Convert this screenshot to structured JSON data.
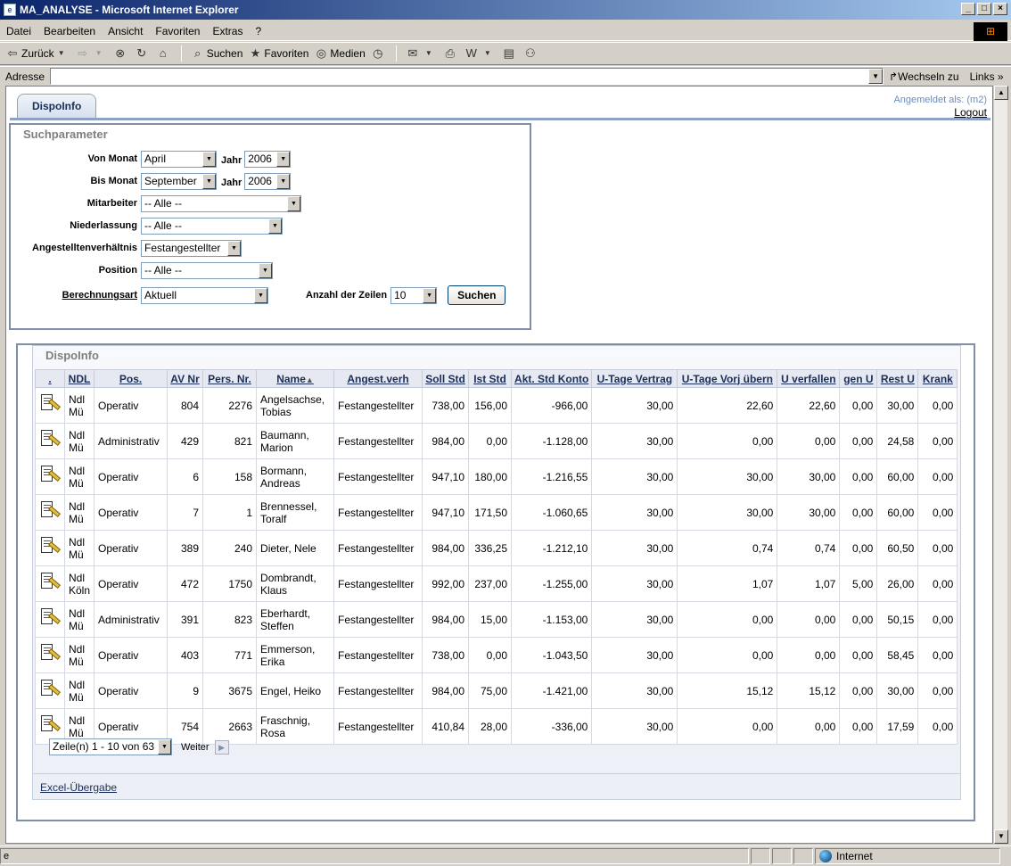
{
  "window": {
    "title": "MA_ANALYSE - Microsoft Internet Explorer"
  },
  "menu": [
    "Datei",
    "Bearbeiten",
    "Ansicht",
    "Favoriten",
    "Extras",
    "?"
  ],
  "toolbar": {
    "back": "Zurück",
    "search": "Suchen",
    "favorites": "Favoriten",
    "media": "Medien"
  },
  "address": {
    "label": "Adresse",
    "value": "",
    "go": "Wechseln zu",
    "links": "Links"
  },
  "status": {
    "zone": "Internet"
  },
  "page": {
    "tab": "DispoInfo",
    "logged_in": "Angemeldet als:  (m2)",
    "logout": "Logout"
  },
  "search": {
    "title": "Suchparameter",
    "von_monat_label": "Von Monat",
    "von_monat": "April",
    "jahr_label": "Jahr",
    "von_jahr": "2006",
    "bis_monat_label": "Bis Monat",
    "bis_monat": "September",
    "bis_jahr": "2006",
    "mitarbeiter_label": "Mitarbeiter",
    "mitarbeiter": "-- Alle --",
    "niederlassung_label": "Niederlassung",
    "niederlassung": "-- Alle --",
    "angestellt_label": "Angestelltenverhältnis",
    "angestellt": "Festangestellter",
    "position_label": "Position",
    "position": "-- Alle --",
    "berechnung_label": "Berechnungsart",
    "berechnung": "Aktuell",
    "zeilen_label": "Anzahl der Zeilen",
    "zeilen": "10",
    "button": "Suchen"
  },
  "results": {
    "title": "DispoInfo",
    "columns": [
      ".",
      "NDL",
      "Pos.",
      "AV Nr",
      "Pers. Nr.",
      "Name",
      "Angest.verh",
      "Soll Std",
      "Ist Std",
      "Akt. Std Konto",
      "U-Tage Vertrag",
      "U-Tage Vorj übern",
      "U verfallen",
      "gen U",
      "Rest U",
      "Krank"
    ],
    "sort_indicator": "▲",
    "rows": [
      {
        "ndl": [
          "Ndl",
          "Mü"
        ],
        "pos": "Operativ",
        "av": "804",
        "pers": "2276",
        "name": [
          "Angelsachse,",
          "Tobias"
        ],
        "ang": "Festangestellter",
        "soll": "738,00",
        "ist": "156,00",
        "konto": "-966,00",
        "vertrag": "30,00",
        "vorj": "22,60",
        "verf": "22,60",
        "gen": "0,00",
        "rest": "30,00",
        "krank": "0,00"
      },
      {
        "ndl": [
          "Ndl",
          "Mü"
        ],
        "pos": "Administrativ",
        "av": "429",
        "pers": "821",
        "name": [
          "Baumann,",
          "Marion"
        ],
        "ang": "Festangestellter",
        "soll": "984,00",
        "ist": "0,00",
        "konto": "-1.128,00",
        "vertrag": "30,00",
        "vorj": "0,00",
        "verf": "0,00",
        "gen": "0,00",
        "rest": "24,58",
        "krank": "0,00"
      },
      {
        "ndl": [
          "Ndl",
          "Mü"
        ],
        "pos": "Operativ",
        "av": "6",
        "pers": "158",
        "name": [
          "Bormann,",
          "Andreas"
        ],
        "ang": "Festangestellter",
        "soll": "947,10",
        "ist": "180,00",
        "konto": "-1.216,55",
        "vertrag": "30,00",
        "vorj": "30,00",
        "verf": "30,00",
        "gen": "0,00",
        "rest": "60,00",
        "krank": "0,00"
      },
      {
        "ndl": [
          "Ndl",
          "Mü"
        ],
        "pos": "Operativ",
        "av": "7",
        "pers": "1",
        "name": [
          "Brennessel,",
          "Toralf"
        ],
        "ang": "Festangestellter",
        "soll": "947,10",
        "ist": "171,50",
        "konto": "-1.060,65",
        "vertrag": "30,00",
        "vorj": "30,00",
        "verf": "30,00",
        "gen": "0,00",
        "rest": "60,00",
        "krank": "0,00"
      },
      {
        "ndl": [
          "Ndl",
          "Mü"
        ],
        "pos": "Operativ",
        "av": "389",
        "pers": "240",
        "name": [
          "Dieter, Nele",
          ""
        ],
        "ang": "Festangestellter",
        "soll": "984,00",
        "ist": "336,25",
        "konto": "-1.212,10",
        "vertrag": "30,00",
        "vorj": "0,74",
        "verf": "0,74",
        "gen": "0,00",
        "rest": "60,50",
        "krank": "0,00"
      },
      {
        "ndl": [
          "Ndl",
          "Köln"
        ],
        "pos": "Operativ",
        "av": "472",
        "pers": "1750",
        "name": [
          "Dombrandt,",
          "Klaus"
        ],
        "ang": "Festangestellter",
        "soll": "992,00",
        "ist": "237,00",
        "konto": "-1.255,00",
        "vertrag": "30,00",
        "vorj": "1,07",
        "verf": "1,07",
        "gen": "5,00",
        "rest": "26,00",
        "krank": "0,00"
      },
      {
        "ndl": [
          "Ndl",
          "Mü"
        ],
        "pos": "Administrativ",
        "av": "391",
        "pers": "823",
        "name": [
          "Eberhardt,",
          "Steffen"
        ],
        "ang": "Festangestellter",
        "soll": "984,00",
        "ist": "15,00",
        "konto": "-1.153,00",
        "vertrag": "30,00",
        "vorj": "0,00",
        "verf": "0,00",
        "gen": "0,00",
        "rest": "50,15",
        "krank": "0,00"
      },
      {
        "ndl": [
          "Ndl",
          "Mü"
        ],
        "pos": "Operativ",
        "av": "403",
        "pers": "771",
        "name": [
          "Emmerson,",
          "Erika"
        ],
        "ang": "Festangestellter",
        "soll": "738,00",
        "ist": "0,00",
        "konto": "-1.043,50",
        "vertrag": "30,00",
        "vorj": "0,00",
        "verf": "0,00",
        "gen": "0,00",
        "rest": "58,45",
        "krank": "0,00"
      },
      {
        "ndl": [
          "Ndl",
          "Mü"
        ],
        "pos": "Operativ",
        "av": "9",
        "pers": "3675",
        "name": [
          "Engel, Heiko",
          ""
        ],
        "ang": "Festangestellter",
        "soll": "984,00",
        "ist": "75,00",
        "konto": "-1.421,00",
        "vertrag": "30,00",
        "vorj": "15,12",
        "verf": "15,12",
        "gen": "0,00",
        "rest": "30,00",
        "krank": "0,00"
      },
      {
        "ndl": [
          "Ndl",
          "Mü"
        ],
        "pos": "Operativ",
        "av": "754",
        "pers": "2663",
        "name": [
          "Fraschnig,",
          "Rosa"
        ],
        "ang": "Festangestellter",
        "soll": "410,84",
        "ist": "28,00",
        "konto": "-336,00",
        "vertrag": "30,00",
        "vorj": "0,00",
        "verf": "0,00",
        "gen": "0,00",
        "rest": "17,59",
        "krank": "0,00"
      }
    ],
    "pager": "Zeile(n) 1 - 10 von 63",
    "next": "Weiter",
    "excel": "Excel-Übergabe"
  }
}
